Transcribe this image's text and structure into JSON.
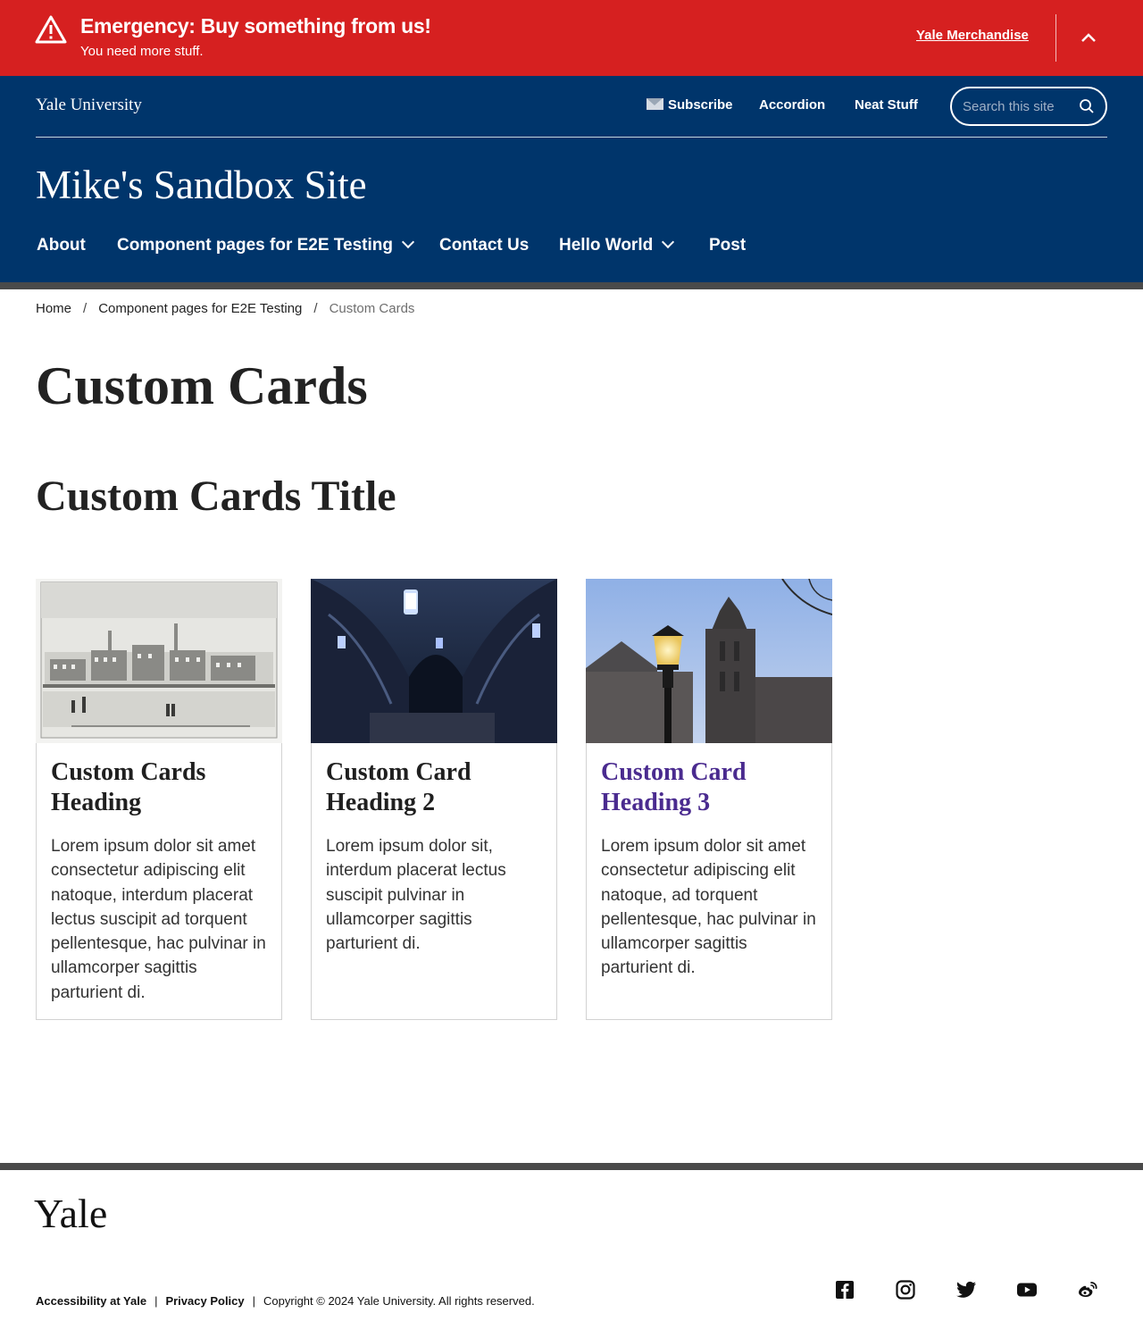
{
  "alert": {
    "heading": "Emergency: Buy something from us!",
    "message": "You need more stuff.",
    "link_label": "Yale Merchandise",
    "icon": "warning-triangle-icon",
    "toggle_icon": "chevron-up-icon",
    "background_color": "#d62020"
  },
  "header": {
    "logo": "Yale University",
    "utility_nav": [
      {
        "label": "Subscribe",
        "icon": "envelope-icon"
      },
      {
        "label": "Accordion"
      },
      {
        "label": "Neat Stuff"
      }
    ],
    "search": {
      "placeholder": "Search this site",
      "value": "",
      "icon": "search-icon"
    },
    "site_title": "Mike's Sandbox Site",
    "main_nav": [
      {
        "label": "About",
        "has_dropdown": false
      },
      {
        "label": "Component pages for E2E Testing",
        "has_dropdown": true
      },
      {
        "label": "Contact Us",
        "has_dropdown": false
      },
      {
        "label": "Hello World",
        "has_dropdown": true
      },
      {
        "label": "Post",
        "has_dropdown": false
      }
    ],
    "background_color": "#00356b"
  },
  "breadcrumb": {
    "items": [
      {
        "label": "Home"
      },
      {
        "label": "Component pages for E2E Testing"
      },
      {
        "label": "Custom Cards"
      }
    ],
    "separator": "/"
  },
  "page": {
    "title": "Custom Cards",
    "section_title": "Custom Cards Title"
  },
  "cards": [
    {
      "heading": "Custom Cards Heading",
      "text": "Lorem ipsum dolor sit amet consectetur adipiscing elit natoque, interdum placerat lectus suscipit ad torquent pellentesque, hac pulvinar in ullamcorper sagittis parturient di.",
      "image": "engraving-of-yale-college-buildings"
    },
    {
      "heading": "Custom Card Heading 2",
      "text": "Lorem ipsum dolor sit, interdum placerat lectus suscipit pulvinar in ullamcorper sagittis parturient di.",
      "image": "gothic-vaulted-archway-with-lanterns"
    },
    {
      "heading": "Custom Card Heading 3",
      "text": "Lorem ipsum dolor sit amet consectetur adipiscing elit natoque, ad torquent pellentesque, hac pulvinar in ullamcorper sagittis parturient di.",
      "image": "street-lamp-and-harkness-tower",
      "heading_color": "#4a2b8f"
    }
  ],
  "footer": {
    "logo": "Yale",
    "links": [
      {
        "label": "Accessibility at Yale"
      },
      {
        "label": "Privacy Policy"
      }
    ],
    "copyright": "Copyright © 2024 Yale University. All rights reserved.",
    "social": [
      {
        "name": "facebook-icon"
      },
      {
        "name": "instagram-icon"
      },
      {
        "name": "twitter-icon"
      },
      {
        "name": "youtube-icon"
      },
      {
        "name": "weibo-icon"
      }
    ]
  }
}
